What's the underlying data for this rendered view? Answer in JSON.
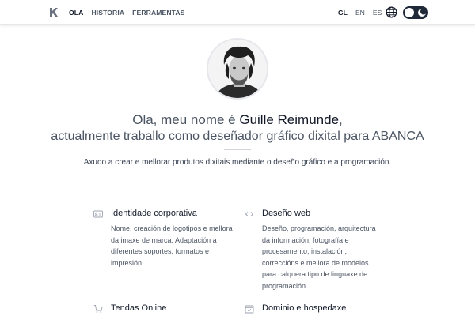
{
  "nav": {
    "items": [
      {
        "label": "OLA",
        "active": true
      },
      {
        "label": "HISTORIA",
        "active": false
      },
      {
        "label": "FERRAMENTAS",
        "active": false
      }
    ]
  },
  "languages": [
    {
      "label": "GL",
      "active": true
    },
    {
      "label": "EN",
      "active": false
    },
    {
      "label": "ES",
      "active": false
    }
  ],
  "icons": {
    "logo": "logo-icon",
    "globe": "globe-icon",
    "theme": "moon-icon"
  },
  "hero": {
    "greeting": "Ola, meu nome é ",
    "name": "Guille Reimunde",
    "greeting_end": ",",
    "subline": "actualmente traballo como deseñador gráfico dixital para ABANCA",
    "tagline": "Axudo a crear e mellorar produtos dixitais mediante o deseño gráfico e a programación."
  },
  "services": [
    {
      "title": "Identidade corporativa",
      "icon": "id-card-icon",
      "description": "Nome, creación de logotipos e mellora da imaxe de marca. Adaptación a diferentes soportes, formatos e impresión."
    },
    {
      "title": "Deseño web",
      "icon": "code-icon",
      "description": "Deseño, programación, arquitectura da información, fotografía e procesamento, instalación, correccións e mellora de modelos para calquera tipo de linguaxe de programación."
    },
    {
      "title": "Tendas Online",
      "icon": "cart-icon",
      "description": ""
    },
    {
      "title": "Dominio e hospedaxe",
      "icon": "calendar-check-icon",
      "description": ""
    }
  ],
  "colors": {
    "text_dark": "#111827",
    "text_muted": "#4b5563",
    "toggle_bg": "#1f2937"
  }
}
